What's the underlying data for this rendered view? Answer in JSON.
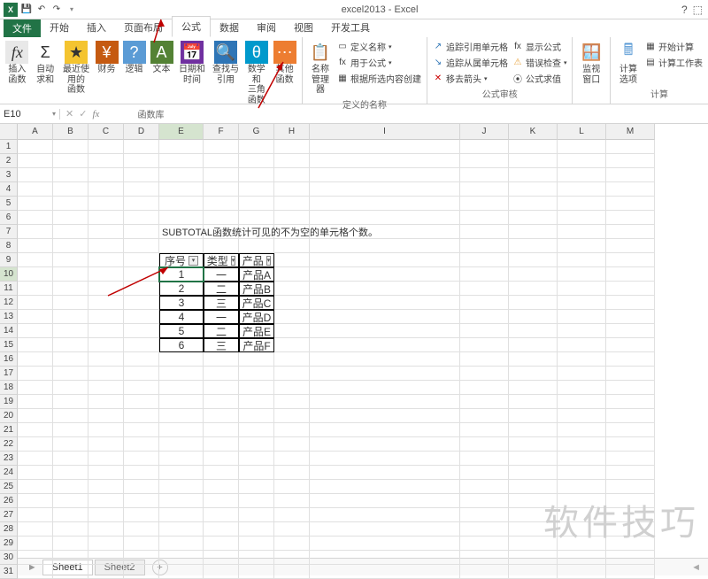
{
  "app": {
    "title": "excel2013 - Excel"
  },
  "qat": {
    "save_name": "save-icon",
    "undo_name": "undo-icon",
    "redo_name": "redo-icon"
  },
  "menutabs": {
    "file": "文件",
    "home": "开始",
    "insert": "插入",
    "layout": "页面布局",
    "formula": "公式",
    "data": "数据",
    "review": "审阅",
    "view": "视图",
    "dev": "开发工具"
  },
  "ribbon": {
    "insert_fn": "插入函数",
    "autosum": "自动求和",
    "recent": "最近使用的\n函数",
    "finance": "财务",
    "logic": "逻辑",
    "text": "文本",
    "datetime": "日期和时间",
    "lookup": "查找与引用",
    "math": "数学和\n三角函数",
    "other": "其他函数",
    "group_fnlib": "函数库",
    "name_mgr": "名称\n管理器",
    "def_name": "定义名称",
    "use_formula": "用于公式",
    "from_sel": "根据所选内容创建",
    "group_names": "定义的名称",
    "trace_prec": "追踪引用单元格",
    "trace_dep": "追踪从属单元格",
    "remove_arrows": "移去箭头",
    "show_formulas": "显示公式",
    "error_check": "错误检查",
    "eval_formula": "公式求值",
    "group_audit": "公式审核",
    "watch": "监视窗口",
    "calc_opts": "计算选项",
    "calc_now": "开始计算",
    "calc_sheet": "计算工作表",
    "group_calc": "计算"
  },
  "namebox": "E10",
  "formula_value": "",
  "columns": [
    "A",
    "B",
    "C",
    "D",
    "E",
    "F",
    "G",
    "H",
    "I",
    "J",
    "K",
    "L",
    "M"
  ],
  "note_text": "SUBTOTAL函数统计可见的不为空的单元格个数。",
  "table": {
    "headers": {
      "seq": "序号",
      "type": "类型",
      "product": "产品"
    },
    "rows": [
      {
        "seq": "1",
        "type": "一",
        "product": "产品A"
      },
      {
        "seq": "2",
        "type": "二",
        "product": "产品B"
      },
      {
        "seq": "3",
        "type": "三",
        "product": "产品C"
      },
      {
        "seq": "4",
        "type": "一",
        "product": "产品D"
      },
      {
        "seq": "5",
        "type": "二",
        "product": "产品E"
      },
      {
        "seq": "6",
        "type": "三",
        "product": "产品F"
      }
    ]
  },
  "sheets": {
    "s1": "Sheet1",
    "s2": "Sheet2"
  },
  "watermark": "软件技巧"
}
